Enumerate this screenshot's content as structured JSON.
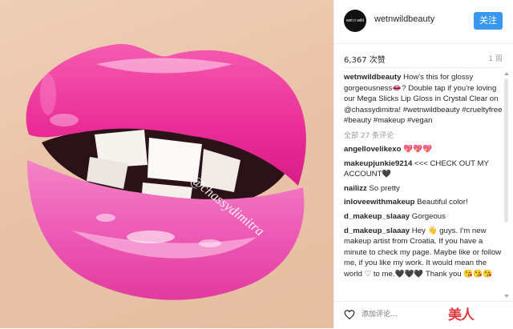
{
  "post": {
    "username": "wetnwildbeauty",
    "avatar_text": "wet n wild",
    "follow_label": "关注",
    "likes": "6,367 次赞",
    "time_ago": "1 周",
    "photo_watermark": "@chassydimitra",
    "more_comments": "全部 27 条评论"
  },
  "comments": [
    {
      "user": "wetnwildbeauty",
      "text": " How's this for glossy gorgeousness👄? Double tap if you're loving our Mega Slicks Lip Gloss in Crystal Clear on @chassydimitra! #wetnwildbeauty #crueltyfree #beauty #makeup #vegan"
    },
    {
      "user": "angellovelikexo",
      "text": " 💖💖💖"
    },
    {
      "user": "makeupjunkie9214",
      "text": " <<< CHECK OUT MY ACCOUNT🖤"
    },
    {
      "user": "nailizz",
      "text": " So pretty"
    },
    {
      "user": "inloveewithmakeup",
      "text": " Beautiful color!"
    },
    {
      "user": "d_makeup_slaaay",
      "text": " Gorgeous"
    },
    {
      "user": "d_makeup_slaaay",
      "text": " Hey 👋 guys. I'm new makeup artist from Croatia. If you have a minute to check my page. Maybe like or follow me, if you like my work. It would mean the world ♡ to me.🖤🖤🖤 Thank you 😘😘😘"
    }
  ],
  "footer": {
    "comment_placeholder": "添加评论...",
    "watermark_logo": "美人"
  },
  "colors": {
    "follow_button": "#3897f0",
    "lip_pink": "#f0329c"
  }
}
